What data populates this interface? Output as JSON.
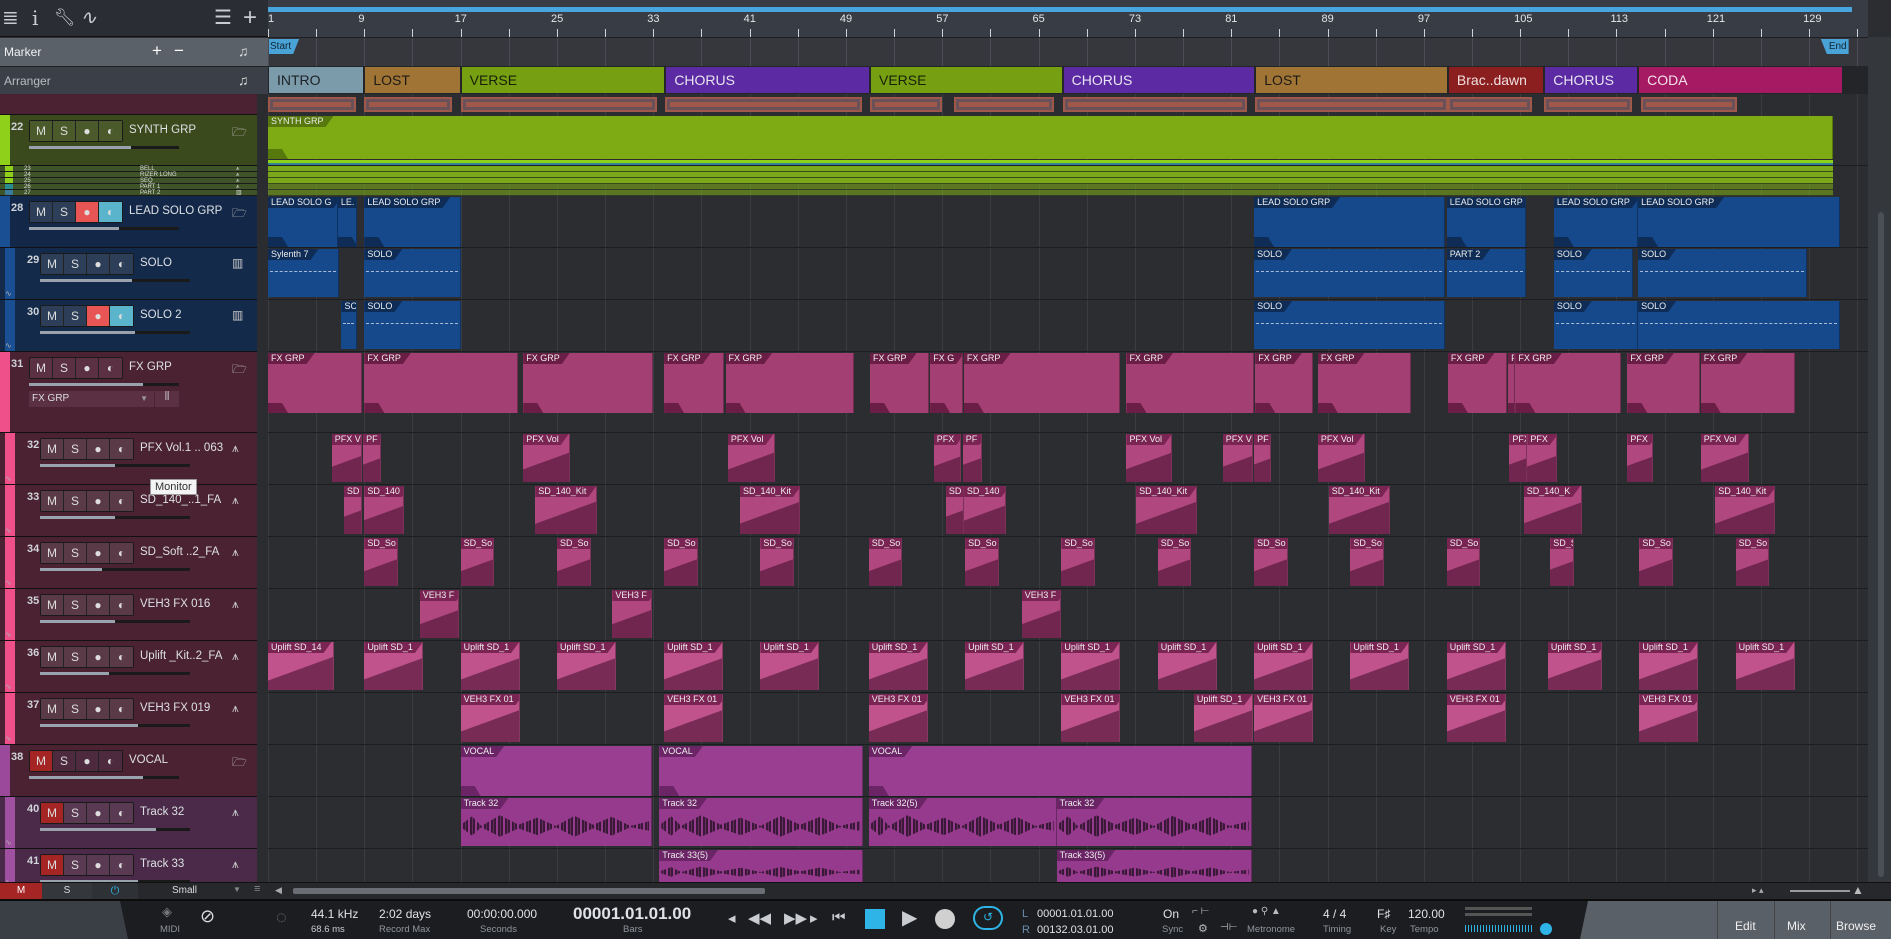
{
  "toolbar": {
    "icons": [
      "menu-icon",
      "info-icon",
      "wrench-icon",
      "automation-icon",
      "track-list-icon",
      "add-track-icon"
    ]
  },
  "marker": {
    "label": "Marker",
    "add": "+",
    "remove": "−",
    "start": "Start",
    "end": "End"
  },
  "arranger": {
    "label": "Arranger"
  },
  "ruler": {
    "bars": [
      "1",
      "9",
      "17",
      "25",
      "33",
      "41",
      "49",
      "57",
      "65",
      "73",
      "81",
      "89",
      "97",
      "105",
      "113",
      "121",
      "129"
    ]
  },
  "sections": [
    {
      "name": "INTRO",
      "start": 1,
      "end": 9,
      "color": "#7b9aaa",
      "text": "#1d2226"
    },
    {
      "name": "LOST",
      "start": 9,
      "end": 17,
      "color": "#a07435",
      "text": "#1d1a14"
    },
    {
      "name": "VERSE",
      "start": 17,
      "end": 34,
      "color": "#76a012",
      "text": "#18200a"
    },
    {
      "name": "CHORUS",
      "start": 34,
      "end": 51,
      "color": "#5c2aa3",
      "text": "#e8e4f2"
    },
    {
      "name": "VERSE",
      "start": 51,
      "end": 67,
      "color": "#76a012",
      "text": "#18200a"
    },
    {
      "name": "CHORUS",
      "start": 67,
      "end": 83,
      "color": "#5c2aa3",
      "text": "#e8e4f2"
    },
    {
      "name": "LOST",
      "start": 83,
      "end": 99,
      "color": "#a07435",
      "text": "#1d1a14"
    },
    {
      "name": "Brac..dawn",
      "start": 99,
      "end": 107,
      "color": "#8b1f1f",
      "text": "#f0e0e0"
    },
    {
      "name": "CHORUS",
      "start": 107,
      "end": 114.8,
      "color": "#5c2aa3",
      "text": "#e8e4f2"
    },
    {
      "name": "CODA",
      "start": 114.8,
      "end": 131.8,
      "color": "#a51a63",
      "text": "#f2e2ea"
    }
  ],
  "overview_blocks": [
    [
      1,
      8.3
    ],
    [
      9,
      16.3
    ],
    [
      17,
      33.3
    ],
    [
      34,
      50.3
    ],
    [
      51,
      57
    ],
    [
      58,
      66.3
    ],
    [
      67,
      82.3
    ],
    [
      83,
      99
    ],
    [
      99,
      106
    ],
    [
      107,
      114.3
    ],
    [
      115,
      123
    ]
  ],
  "subtracks": [
    {
      "num": "23",
      "name": "BELL",
      "color": "#8fd11a"
    },
    {
      "num": "24",
      "name": "RIZER LONG",
      "color": "#8fd11a"
    },
    {
      "num": "25",
      "name": "SEQ",
      "color": "#8fd11a"
    },
    {
      "num": "26",
      "name": "PART 1",
      "color": "#2a8c8c"
    },
    {
      "num": "27",
      "name": "PART 2",
      "color": "#3a7a9a"
    }
  ],
  "tracks": [
    {
      "num": "22",
      "name": "SYNTH GRP",
      "kind": "group",
      "icon": "folder-icon",
      "bg": "#3b4a1d",
      "strip": "#8fd11a",
      "btn": "#4a5a2a",
      "mute": false,
      "rec": false,
      "mon": false,
      "fader": 0.68,
      "clip_color": "#7eab14",
      "label_color": "#56780c",
      "clips": [
        [
          1,
          131,
          "SYNTH GRP"
        ]
      ]
    },
    {
      "num": "28",
      "name": "LEAD SOLO GRP",
      "kind": "group",
      "icon": "folder-icon",
      "bg": "#132848",
      "strip": "#1a4f94",
      "btn": "#2c3e58",
      "mute": false,
      "rec": true,
      "mon": true,
      "fader": 0.6,
      "clip_color": "#15498c",
      "label_color": "#0e2c55",
      "clips": [
        [
          1,
          6.8,
          "LEAD SOLO G"
        ],
        [
          6.8,
          8.4,
          "LE."
        ],
        [
          9,
          17,
          "LEAD SOLO GRP"
        ],
        [
          82.9,
          98.8,
          "LEAD SOLO GRP"
        ],
        [
          98.9,
          105.5,
          "LEAD SOLO GRP"
        ],
        [
          107.8,
          114.8,
          "LEAD SOLO GRP"
        ],
        [
          114.8,
          131.6,
          "LEAD SOLO GRP"
        ]
      ]
    },
    {
      "num": "29",
      "name": "SOLO",
      "kind": "child",
      "icon": "keyboard-icon",
      "bg": "#142a4a",
      "strip": "#1a4f94",
      "btn": "#2c3e58",
      "mute": false,
      "rec": false,
      "mon": false,
      "fader": 0.61,
      "clip_color": "#15498c",
      "label_color": "#0e2c55",
      "wave": true,
      "clips": [
        [
          1,
          6.9,
          "Sylenth 7"
        ],
        [
          9,
          17,
          "SOLO"
        ],
        [
          82.9,
          98.8,
          "SOLO"
        ],
        [
          98.9,
          105.5,
          "PART 2"
        ],
        [
          107.8,
          114.4,
          "SOLO"
        ],
        [
          114.8,
          128.8,
          "SOLO"
        ]
      ]
    },
    {
      "num": "30",
      "name": "SOLO 2",
      "kind": "child",
      "icon": "keyboard-icon",
      "bg": "#142a4a",
      "strip": "#1a4f94",
      "btn": "#2c3e58",
      "mute": false,
      "rec": true,
      "mon": true,
      "fader": 0.63,
      "clip_color": "#15498c",
      "label_color": "#0e2c55",
      "wave": true,
      "clips": [
        [
          7.1,
          8.4,
          "SO"
        ],
        [
          9,
          17,
          "SOLO"
        ],
        [
          82.9,
          98.8,
          "SOLO"
        ],
        [
          107.8,
          114.8,
          "SOLO"
        ],
        [
          114.8,
          131.6,
          "SOLO"
        ]
      ]
    },
    {
      "num": "31",
      "name": "FX GRP",
      "kind": "group",
      "icon": "folder-icon",
      "bg": "#4a2231",
      "strip": "#f0508a",
      "btn": "#5a3042",
      "mute": false,
      "rec": false,
      "mon": false,
      "fader": 0.76,
      "bus": "FX GRP",
      "clip_color": "#a33f72",
      "label_color": "#6a1d45",
      "clips": [
        [
          1,
          8.8,
          "FX GRP"
        ],
        [
          9,
          21.8,
          "FX GRP"
        ],
        [
          22.2,
          33,
          "FX GRP"
        ],
        [
          33.9,
          38.9,
          "FX GRP"
        ],
        [
          39,
          49.7,
          "FX GRP"
        ],
        [
          51,
          55.9,
          "FX GRP"
        ],
        [
          56,
          58.7,
          "FX G"
        ],
        [
          58.8,
          71.8,
          "FX GRP"
        ],
        [
          72.3,
          82.9,
          "FX GRP"
        ],
        [
          83,
          87.8,
          "FX GRP"
        ],
        [
          88.2,
          95.9,
          "FX GRP"
        ],
        [
          99,
          103.9,
          "FX GRP"
        ],
        [
          104,
          104.6,
          "FX"
        ],
        [
          104.6,
          113.4,
          "FX GRP"
        ],
        [
          113.9,
          119.9,
          "FX GRP"
        ],
        [
          120,
          127.8,
          "FX GRP"
        ]
      ]
    },
    {
      "num": "32",
      "name": "PFX Vol.1 .. 063",
      "kind": "child",
      "icon": "waveform-icon",
      "bg": "#4a2231",
      "strip": "#f0508a",
      "btn": "#5a3a46",
      "mute": false,
      "rec": false,
      "mon": false,
      "fader": 0.5,
      "clip_color": "#b0477e",
      "label_color": "#7a2453",
      "clips": [
        [
          6.3,
          8.8,
          "PFX V"
        ],
        [
          8.9,
          10.4,
          "PF"
        ],
        [
          22.2,
          26.1,
          "PFX Vol"
        ],
        [
          39.2,
          43.1,
          "PFX Vol"
        ],
        [
          56.3,
          58.6,
          "PFX"
        ],
        [
          58.7,
          60.3,
          "PF"
        ],
        [
          72.3,
          76.1,
          "PFX Vol"
        ],
        [
          80.3,
          82.8,
          "PFX V"
        ],
        [
          82.9,
          84.3,
          "PF"
        ],
        [
          88.2,
          92.1,
          "PFX Vol"
        ],
        [
          104.1,
          105.6,
          "PFX"
        ],
        [
          105.6,
          108.1,
          "PFX"
        ],
        [
          113.9,
          116,
          "PFX"
        ],
        [
          120,
          124,
          "PFX Vol"
        ]
      ]
    },
    {
      "num": "33",
      "name": "SD_140_..1_FA",
      "kind": "child",
      "icon": "waveform-icon",
      "bg": "#4a2231",
      "strip": "#f0508a",
      "btn": "#5a3a46",
      "mute": false,
      "rec": false,
      "mon": false,
      "fader": 0.5,
      "clip_color": "#b0477e",
      "label_color": "#7a2453",
      "clips": [
        [
          7.3,
          8.8,
          "SD"
        ],
        [
          9,
          12.3,
          "SD_140"
        ],
        [
          23.2,
          28.3,
          "SD_140_Kit"
        ],
        [
          40.2,
          45.2,
          "SD_140_Kit"
        ],
        [
          57.3,
          58.8,
          "SD"
        ],
        [
          58.8,
          62.3,
          "SD_140"
        ],
        [
          73.1,
          78.2,
          "SD_140_Kit"
        ],
        [
          89.1,
          94.2,
          "SD_140_Kit"
        ],
        [
          105.3,
          110.1,
          "SD_140_K"
        ],
        [
          121.2,
          126.2,
          "SD_140_Kit"
        ]
      ]
    },
    {
      "num": "34",
      "name": "SD_Soft ..2_FA",
      "kind": "child",
      "icon": "waveform-icon",
      "bg": "#4a2231",
      "strip": "#f0508a",
      "btn": "#5a3a46",
      "mute": false,
      "rec": false,
      "mon": false,
      "fader": 0.41,
      "clip_color": "#b0477e",
      "label_color": "#7a2453",
      "clips": [
        [
          9,
          11.8,
          "SD_So"
        ],
        [
          17,
          19.8,
          "SD_So"
        ],
        [
          25,
          27.8,
          "SD_So"
        ],
        [
          33.9,
          36.7,
          "SD_So"
        ],
        [
          41.9,
          44.7,
          "SD_So"
        ],
        [
          50.9,
          53.7,
          "SD_So"
        ],
        [
          58.9,
          61.7,
          "SD_So"
        ],
        [
          66.9,
          69.7,
          "SD_So"
        ],
        [
          74.9,
          77.7,
          "SD_So"
        ],
        [
          82.9,
          85.7,
          "SD_So"
        ],
        [
          90.9,
          93.7,
          "SD_So"
        ],
        [
          98.9,
          101.7,
          "SD_So"
        ],
        [
          107.5,
          109.5,
          "SD_S"
        ],
        [
          114.9,
          117.7,
          "SD_So"
        ],
        [
          122.9,
          125.7,
          "SD_So"
        ]
      ]
    },
    {
      "num": "35",
      "name": "VEH3 FX 016",
      "kind": "child",
      "icon": "waveform-icon",
      "bg": "#4a2231",
      "strip": "#f0508a",
      "btn": "#5a3a46",
      "mute": false,
      "rec": false,
      "mon": false,
      "fader": 0.5,
      "clip_color": "#b0477e",
      "label_color": "#7a2453",
      "clips": [
        [
          13.6,
          16.9,
          "VEH3 F"
        ],
        [
          29.6,
          32.9,
          "VEH3 F"
        ],
        [
          63.6,
          66.9,
          "VEH3 F"
        ]
      ]
    },
    {
      "num": "36",
      "name": "Uplift _Kit..2_FA",
      "kind": "child",
      "icon": "waveform-icon",
      "bg": "#4a2231",
      "strip": "#f0508a",
      "btn": "#5a3a46",
      "mute": false,
      "rec": false,
      "mon": false,
      "fader": 0.46,
      "clip_color": "#c0538c",
      "label_color": "#7a2453",
      "clips": [
        [
          1,
          6.5,
          "Uplift SD_14"
        ],
        [
          9,
          13.9,
          "Uplift SD_1"
        ],
        [
          17,
          21.9,
          "Uplift SD_1"
        ],
        [
          25,
          29.9,
          "Uplift SD_1"
        ],
        [
          33.9,
          38.8,
          "Uplift SD_1"
        ],
        [
          41.9,
          46.8,
          "Uplift SD_1"
        ],
        [
          50.9,
          55.8,
          "Uplift SD_1"
        ],
        [
          58.9,
          63.8,
          "Uplift SD_1"
        ],
        [
          66.9,
          71.8,
          "Uplift SD_1"
        ],
        [
          74.9,
          79.8,
          "Uplift SD_1"
        ],
        [
          82.9,
          87.8,
          "Uplift SD_1"
        ],
        [
          90.9,
          95.8,
          "Uplift SD_1"
        ],
        [
          98.9,
          103.8,
          "Uplift SD_1"
        ],
        [
          107.3,
          111.8,
          "Uplift SD_1"
        ],
        [
          114.9,
          119.8,
          "Uplift SD_1"
        ],
        [
          122.9,
          127.8,
          "Uplift SD_1"
        ]
      ]
    },
    {
      "num": "37",
      "name": "VEH3 FX 019",
      "kind": "child",
      "icon": "waveform-icon",
      "bg": "#4a2231",
      "strip": "#f0508a",
      "btn": "#5a3a46",
      "mute": false,
      "rec": false,
      "mon": false,
      "fader": 0.65,
      "clip_color": "#c0538c",
      "label_color": "#7a2453",
      "clips": [
        [
          17,
          21.9,
          "VEH3 FX 01"
        ],
        [
          33.9,
          38.8,
          "VEH3 FX 01"
        ],
        [
          50.9,
          55.8,
          "VEH3 FX 01"
        ],
        [
          66.9,
          71.8,
          "VEH3 FX 01"
        ],
        [
          77.9,
          82.8,
          "Uplift SD_1"
        ],
        [
          82.9,
          87.8,
          "VEH3 FX 01"
        ],
        [
          98.9,
          103.8,
          "VEH3 FX 01"
        ],
        [
          114.9,
          119.8,
          "VEH3 FX 01"
        ]
      ]
    },
    {
      "num": "38",
      "name": "VOCAL",
      "kind": "group",
      "icon": "folder-icon",
      "bg": "#4a2231",
      "strip": "#9b4a9b",
      "btn": "#4e2a3e",
      "mute": true,
      "rec": false,
      "mon": false,
      "fader": 0.76,
      "clip_color": "#9a3e92",
      "label_color": "#6b2466",
      "clips": [
        [
          17,
          32.9,
          "VOCAL"
        ],
        [
          33.5,
          50.4,
          "VOCAL"
        ],
        [
          50.9,
          82.7,
          "VOCAL"
        ]
      ]
    },
    {
      "num": "40",
      "name": "Track 32",
      "kind": "child",
      "icon": "waveform-icon",
      "bg": "#4a2a48",
      "strip": "#a050a0",
      "btn": "#5a3a52",
      "mute": true,
      "rec": false,
      "mon": false,
      "fader": 0.77,
      "clip_color": "#953a8c",
      "label_color": "#6b2466",
      "audio": true,
      "clips": [
        [
          17,
          32.9,
          "Track 32"
        ],
        [
          33.5,
          50.4,
          "Track 32"
        ],
        [
          50.9,
          66.5,
          "Track 32(5)"
        ],
        [
          66.5,
          82.7,
          "Track 32"
        ]
      ]
    },
    {
      "num": "41",
      "name": "Track 33",
      "kind": "child",
      "icon": "waveform-icon",
      "bg": "#4a2a48",
      "strip": "#a050a0",
      "btn": "#5a3a52",
      "mute": true,
      "rec": false,
      "mon": false,
      "fader": 0.65,
      "clip_color": "#953a8c",
      "label_color": "#6b2466",
      "audio": true,
      "clips": [
        [
          33.5,
          50.4,
          "Track 33(5)"
        ],
        [
          66.5,
          82.7,
          "Track 33(5)"
        ]
      ]
    }
  ],
  "tooltip": "Monitor",
  "footer": {
    "mute": "M",
    "solo": "S",
    "size": "Small"
  },
  "transport": {
    "midi": "MIDI",
    "sample_rate": "44.1 kHz",
    "latency": "68.6 ms",
    "record_max": "2:02 days",
    "record_max_label": "Record Max",
    "seconds": "00:00:00.000",
    "seconds_label": "Seconds",
    "bars": "00001.01.01.00",
    "bars_label": "Bars",
    "loop_l_label": "L",
    "loop_l": "00001.01.01.00",
    "loop_r_label": "R",
    "loop_r": "00132.03.01.00",
    "sync": "On",
    "sync_label": "Sync",
    "metronome_label": "Metronome",
    "timing": "4 / 4",
    "timing_label": "Timing",
    "key": "F♯",
    "key_label": "Key",
    "tempo": "120.00",
    "tempo_label": "Tempo",
    "accent": "#2eb4e6"
  },
  "views": {
    "edit": "Edit",
    "mix": "Mix",
    "browse": "Browse"
  }
}
